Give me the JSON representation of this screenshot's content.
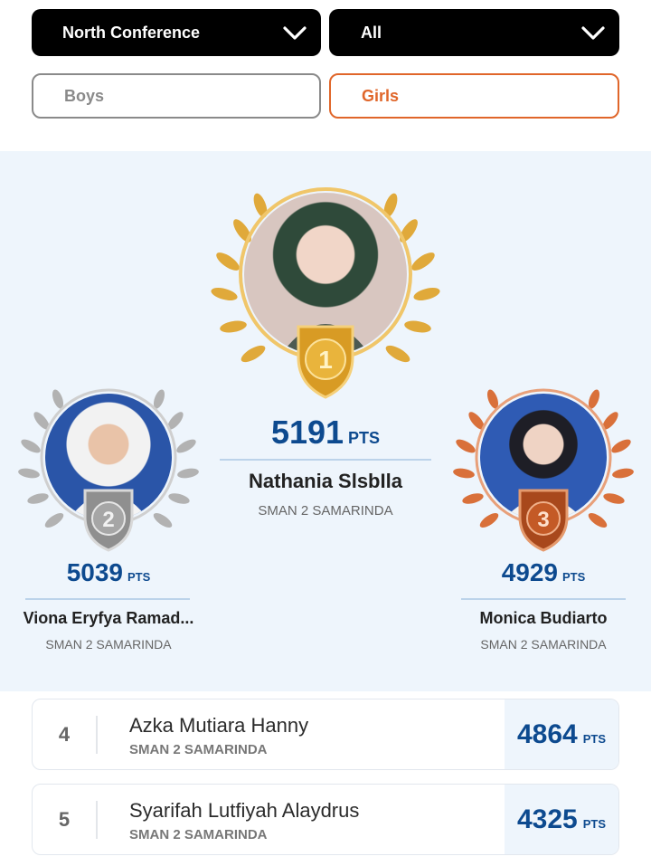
{
  "filters": {
    "conference": "North Conference",
    "category": "All",
    "tabs": [
      {
        "label": "Boys",
        "active": false
      },
      {
        "label": "Girls",
        "active": true
      }
    ]
  },
  "colors": {
    "accent": "#e0662a",
    "points": "#0d4a8f",
    "gold": "#e0a93a",
    "silver": "#9a9a9a",
    "bronze": "#c9652b",
    "podium_bg": "#eef5fc"
  },
  "podium": {
    "unit": "PTS",
    "first": {
      "rank": "1",
      "points": "5191",
      "name": "Nathania SlsbIla",
      "school": "SMAN 2 SAMARINDA"
    },
    "second": {
      "rank": "2",
      "points": "5039",
      "name": "Viona Eryfya Ramad...",
      "school": "SMAN 2 SAMARINDA"
    },
    "third": {
      "rank": "3",
      "points": "4929",
      "name": "Monica Budiarto",
      "school": "SMAN 2 SAMARINDA"
    }
  },
  "list": [
    {
      "rank": "4",
      "name": "Azka Mutiara Hanny",
      "school": "SMAN 2 SAMARINDA",
      "points": "4864",
      "unit": "PTS"
    },
    {
      "rank": "5",
      "name": "Syarifah Lutfiyah Alaydrus",
      "school": "SMAN 2 SAMARINDA",
      "points": "4325",
      "unit": "PTS"
    }
  ]
}
